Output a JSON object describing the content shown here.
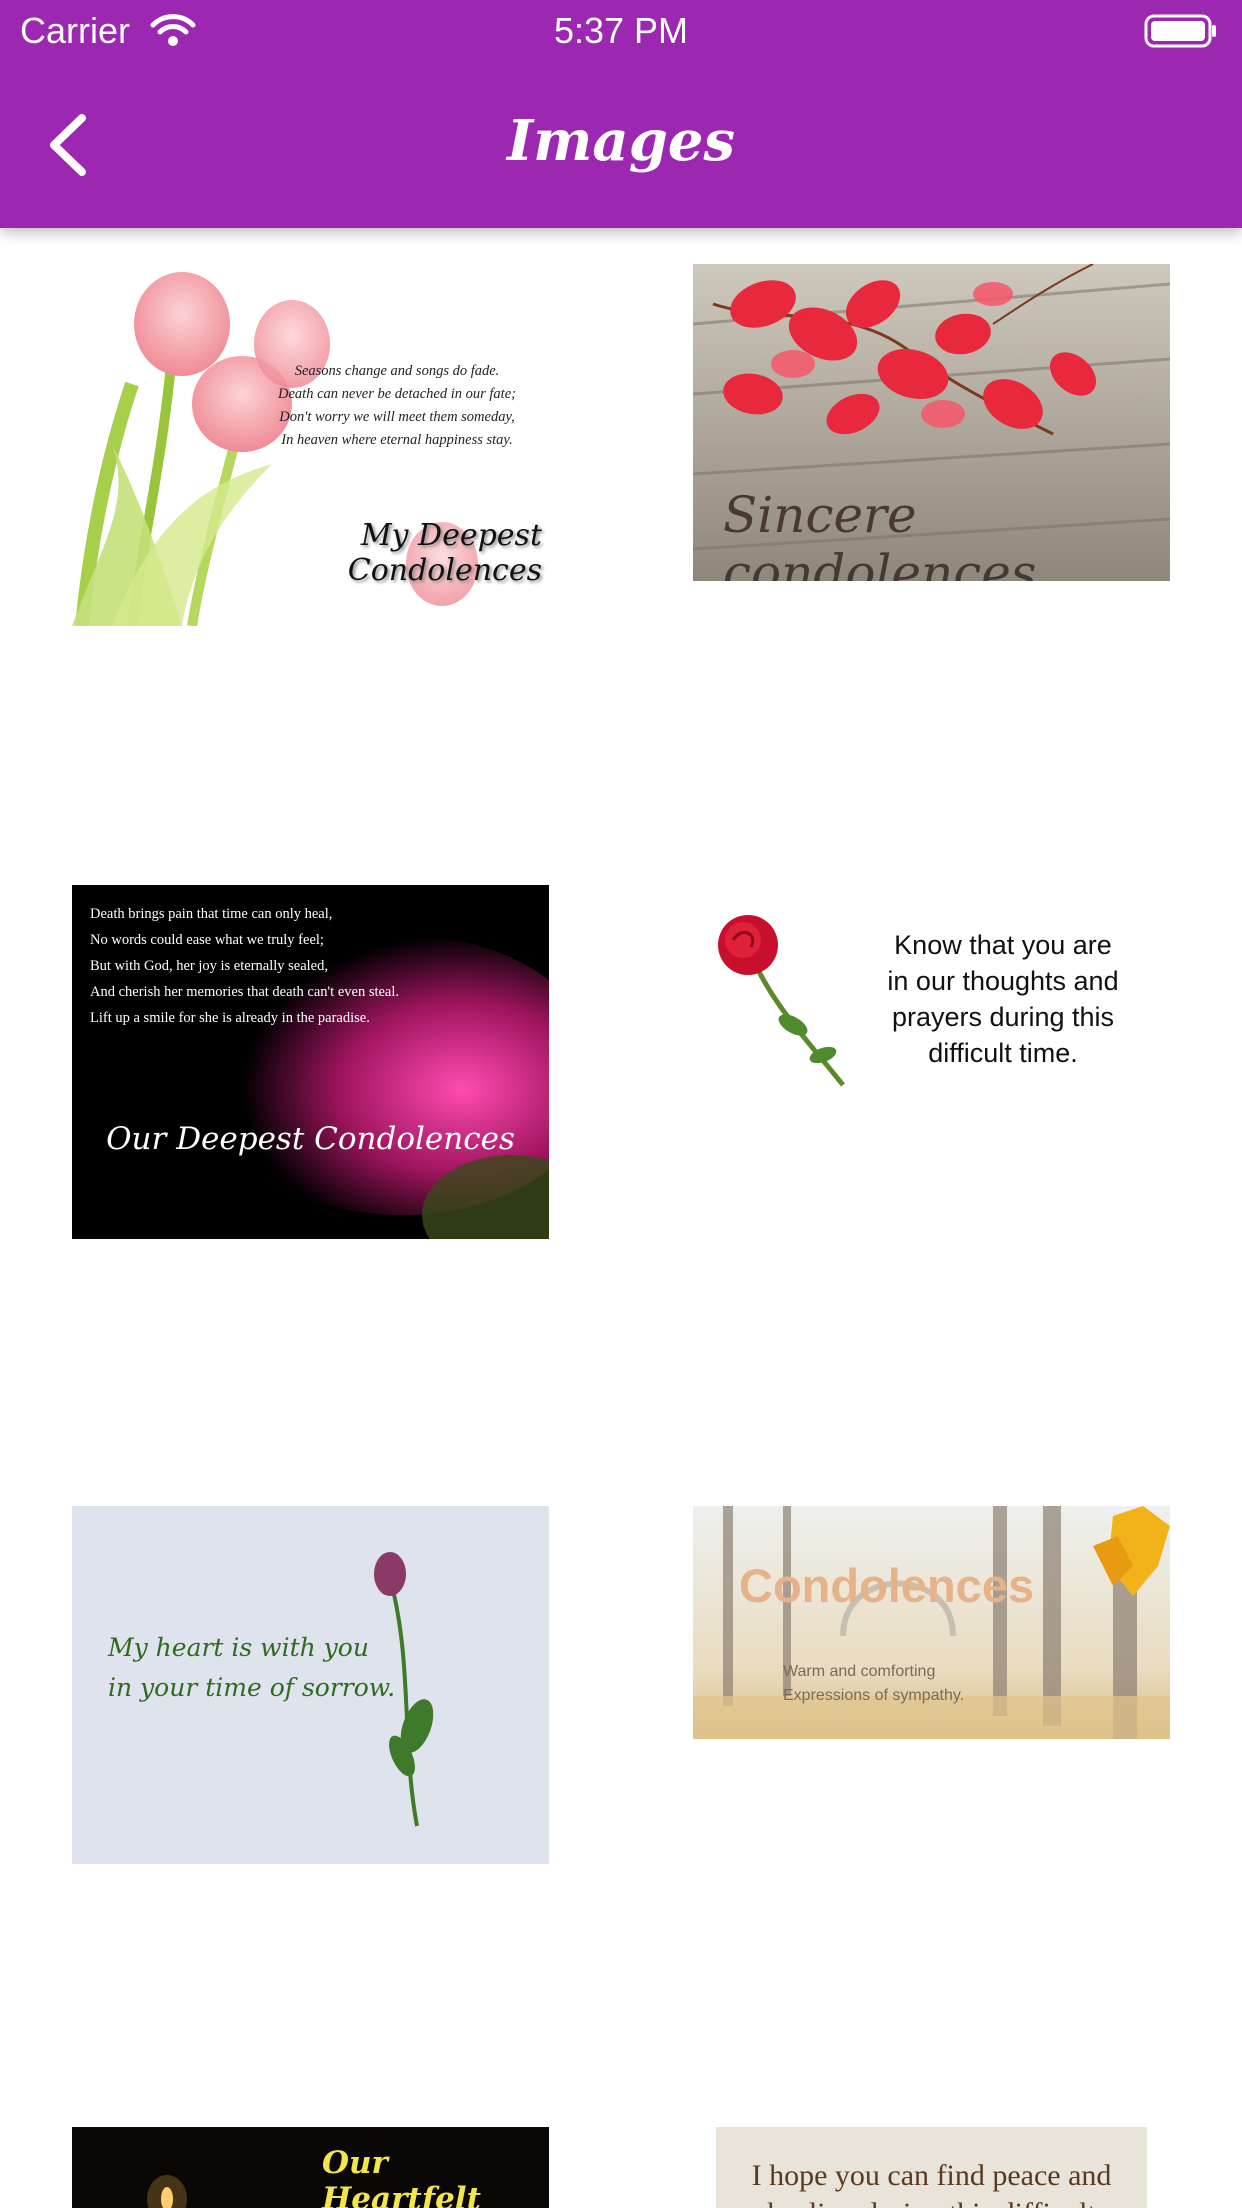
{
  "status_bar": {
    "carrier": "Carrier",
    "time": "5:37 PM"
  },
  "nav": {
    "title": "Images",
    "back_icon": "chevron-left-icon"
  },
  "colors": {
    "header": "#9c27b0",
    "header_text": "#ffffff",
    "background": "#ffffff"
  },
  "cards": [
    {
      "poem": "Seasons change and songs do fade.\nDeath can never be detached in our fate;\nDon't worry we will meet them someday,\nIn heaven where eternal happiness stay.",
      "caption": "My Deepest Condolences"
    },
    {
      "caption": "Sincere condolences"
    },
    {
      "poem": "Death brings pain that time can only heal,\nNo words could ease what we truly feel;\nBut with God, her joy is eternally sealed,\nAnd cherish her memories that death can't even steal.\nLift up a smile for she is already in the paradise.",
      "caption": "Our Deepest Condolences"
    },
    {
      "message": "Know that you are\nin our thoughts and\nprayers during this\ndifficult time."
    },
    {
      "message": "My heart is with you\nin your time of sorrow."
    },
    {
      "heading": "Condolences",
      "subtext": "Warm and comforting\nExpressions of sympathy."
    },
    {
      "heading": "Our Heartfelt"
    },
    {
      "message": "I hope you can find peace and\nhealing during this difficult"
    }
  ]
}
